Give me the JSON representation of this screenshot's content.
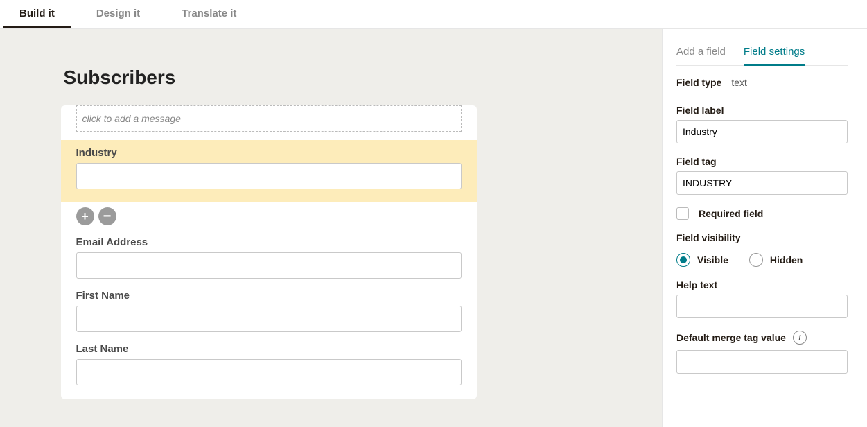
{
  "tabs": {
    "build": "Build it",
    "design": "Design it",
    "translate": "Translate it"
  },
  "form": {
    "title": "Subscribers",
    "message_placeholder": "click to add a message",
    "fields": {
      "industry": {
        "label": "Industry",
        "value": ""
      },
      "email": {
        "label": "Email Address",
        "value": ""
      },
      "first": {
        "label": "First Name",
        "value": ""
      },
      "last": {
        "label": "Last Name",
        "value": ""
      }
    }
  },
  "side": {
    "tabs": {
      "add": "Add a field",
      "settings": "Field settings"
    },
    "field_type": {
      "label": "Field type",
      "value": "text"
    },
    "field_label": {
      "label": "Field label",
      "value": "Industry"
    },
    "field_tag": {
      "label": "Field tag",
      "value": "INDUSTRY"
    },
    "required": {
      "label": "Required field",
      "checked": false
    },
    "visibility": {
      "label": "Field visibility",
      "visible": "Visible",
      "hidden": "Hidden",
      "selected": "visible"
    },
    "help_text": {
      "label": "Help text",
      "value": ""
    },
    "default_merge": {
      "label": "Default merge tag value",
      "value": ""
    }
  }
}
